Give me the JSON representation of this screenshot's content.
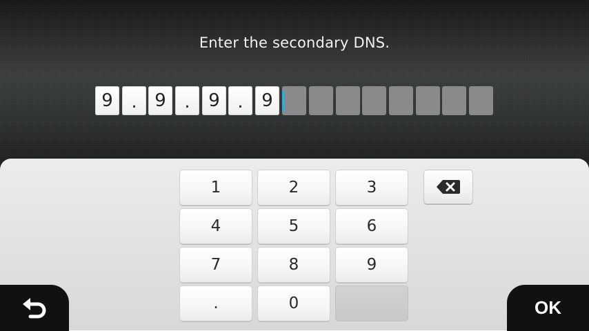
{
  "header": {
    "prompt": "Enter the secondary DNS."
  },
  "input": {
    "cells": [
      "9",
      ".",
      "9",
      ".",
      "9",
      ".",
      "9",
      "",
      "",
      "",
      "",
      "",
      "",
      "",
      ""
    ],
    "caret_after_index": 6
  },
  "keypad": {
    "keys": [
      "1",
      "2",
      "3",
      "4",
      "5",
      "6",
      "7",
      "8",
      "9",
      ".",
      "0",
      ""
    ],
    "backspace_icon": "backspace-icon"
  },
  "footer": {
    "back_icon": "back-arrow-icon",
    "ok_label": "OK"
  },
  "colors": {
    "caret": "#19b7e8",
    "empty_cell": "#8a8a8a",
    "corner_buttons": "#111111"
  }
}
